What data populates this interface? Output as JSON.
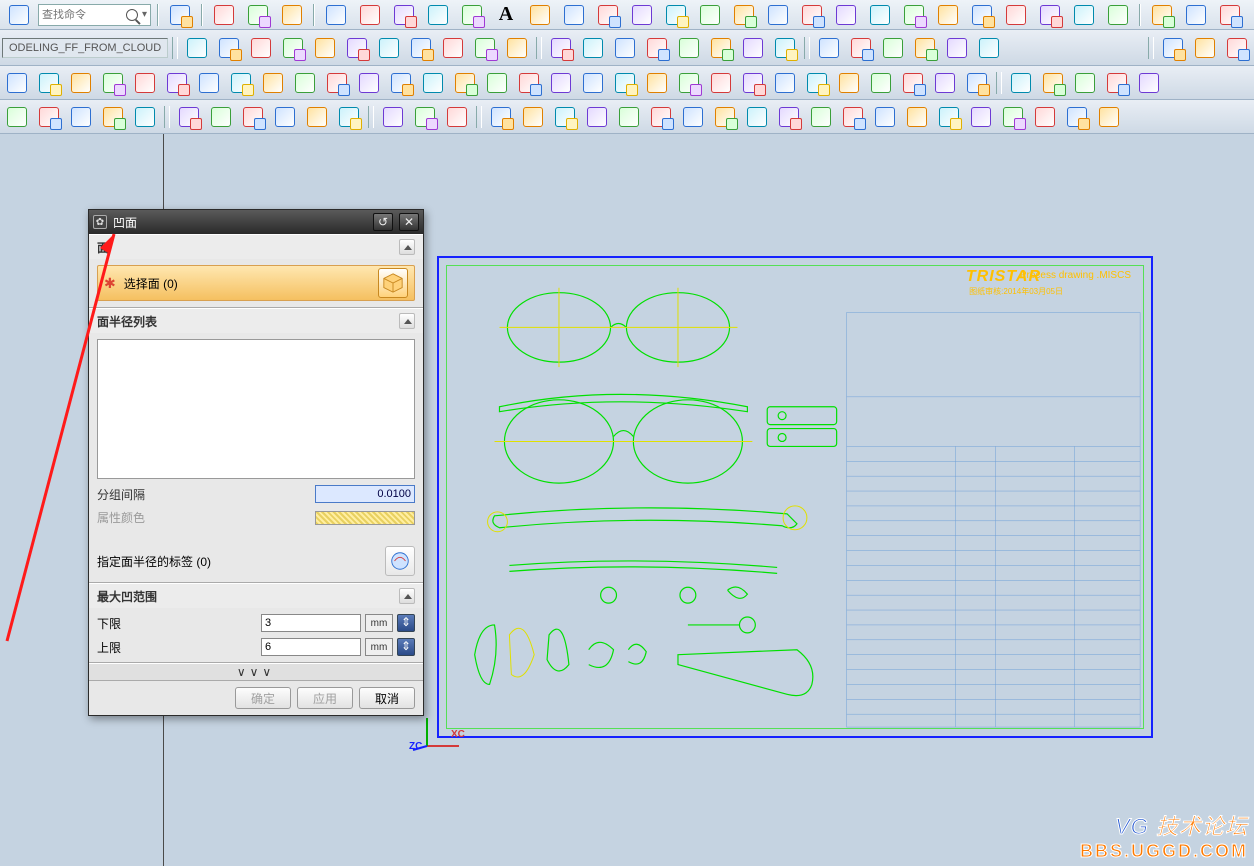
{
  "search": {
    "placeholder": "查找命令"
  },
  "app_tag": "ODELING_FF_FROM_CLOUD",
  "dialog": {
    "title": "凹面",
    "section_face": "面",
    "select_face": "选择面 (0)",
    "section_radius_list": "面半径列表",
    "group_gap_label": "分组间隔",
    "group_gap_value": "0.0100",
    "attr_color_label": "属性颜色",
    "tag_label": "指定面半径的标签 (0)",
    "section_range": "最大凹范围",
    "lower_label": "下限",
    "lower_value": "3",
    "upper_label": "上限",
    "upper_value": "6",
    "unit": "mm",
    "expand": "∨∨∨",
    "ok": "确定",
    "apply": "应用",
    "cancel": "取消"
  },
  "sheet": {
    "brand": "TRISTAR",
    "proc": "Process drawing .MISCS",
    "sub": "图纸审核:2014年03月05日"
  },
  "axes": {
    "zc": "ZC",
    "xc": "XC"
  },
  "watermark": {
    "line1a": "VG",
    "line1b": " 技术论坛",
    "line2": "BBS.UGGD.COM"
  }
}
